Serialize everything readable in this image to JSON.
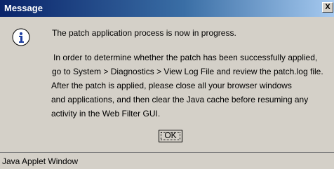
{
  "window": {
    "title": "Message",
    "close_label": "X"
  },
  "icon": "info-icon",
  "message": {
    "line1": "The patch application process is now in progress.",
    "line2": "In order to determine whether the patch has been successfully applied,",
    "line3": "go to System > Diagnostics > View Log File and review the patch.log file.",
    "line4": "After the patch is applied, please close all your browser windows",
    "line5": "and applications, and then clear the Java cache before resuming any",
    "line6": "activity in the Web Filter GUI."
  },
  "buttons": {
    "ok_label": "OK"
  },
  "status_bar": {
    "text": "Java Applet Window"
  },
  "colors": {
    "title_bar_start": "#0a246a",
    "title_bar_end": "#a6caf0",
    "face": "#d4d0c8",
    "icon_blue": "#1e3ea0"
  }
}
